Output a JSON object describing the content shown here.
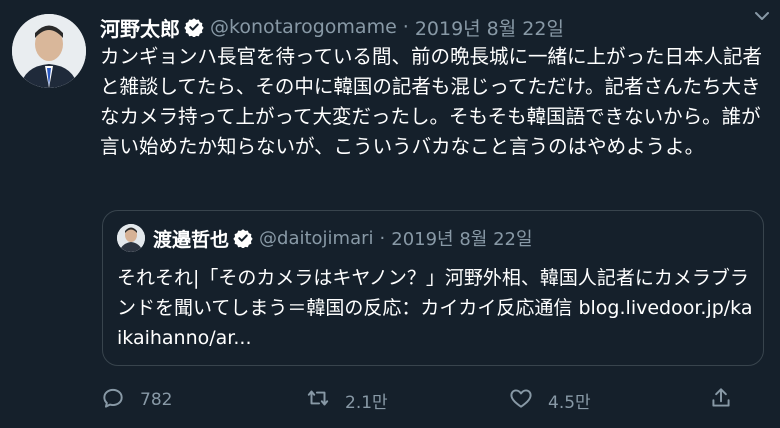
{
  "tweet": {
    "author_name": "河野太郎",
    "author_handle": "@konotarogomame",
    "separator": "·",
    "date": "2019년 8월 22일",
    "text": "カンギョンハ長官を待っている間、前の晩長城に一緒に上がった日本人記者と雑談してたら、その中に韓国の記者も混じってただけ。記者さんたち大きなカメラ持って上がって大変だったし。そもそも韓国語できないから。誰が言い始めたか知らないが、こういうバカなこと言うのはやめようよ。"
  },
  "quote": {
    "author_name": "渡邉哲也",
    "author_handle": "@daitojimari",
    "separator": "·",
    "date": "2019년 8월 22일",
    "text": "それそれ|「そのカメラはキヤノン？」河野外相、韓国人記者にカメラブランドを聞いてしまう＝韓国の反応：カイカイ反応通信 blog.livedoor.jp/kaikaihanno/ar..."
  },
  "actions": {
    "replies": "782",
    "retweets": "2.1만",
    "likes": "4.5만"
  },
  "colors": {
    "background": "#15202b",
    "secondary_text": "#8899a6",
    "border": "#38444d"
  },
  "icons": [
    "verified-icon",
    "chevron-down-icon",
    "reply-icon",
    "retweet-icon",
    "like-icon",
    "share-icon"
  ]
}
